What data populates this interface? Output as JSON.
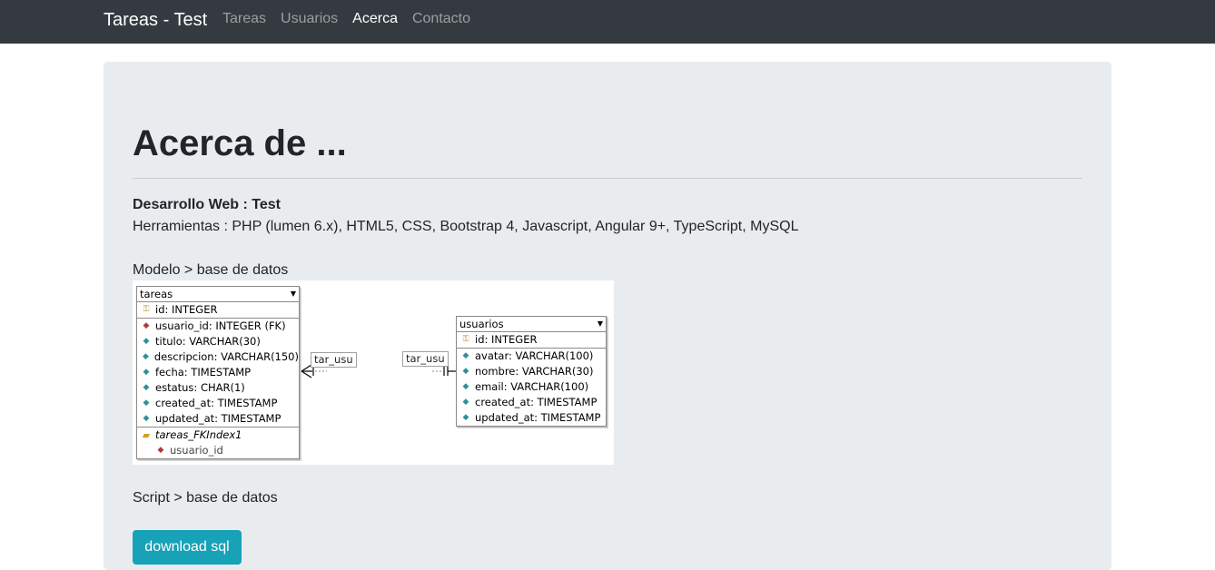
{
  "navbar": {
    "brand": "Tareas - Test",
    "links": [
      "Tareas",
      "Usuarios",
      "Acerca",
      "Contacto"
    ],
    "active": "Acerca"
  },
  "page": {
    "title": "Acerca de ...",
    "dev_line": "Desarrollo Web : Test",
    "tools_line": "Herramientas : PHP (lumen 6.x), HTML5, CSS, Bootstrap 4, Javascript, Angular 9+, TypeScript, MySQL",
    "model_label": "Modelo > base de datos",
    "script_label": "Script > base de datos",
    "download_button": "download sql"
  },
  "diagram": {
    "tareas": {
      "name": "tareas",
      "pk": "id: INTEGER",
      "fields": [
        {
          "icon": "fk",
          "text": "usuario_id: INTEGER (FK)"
        },
        {
          "icon": "col",
          "text": "titulo: VARCHAR(30)"
        },
        {
          "icon": "col",
          "text": "descripcion: VARCHAR(150)"
        },
        {
          "icon": "col",
          "text": "fecha: TIMESTAMP"
        },
        {
          "icon": "col",
          "text": "estatus: CHAR(1)"
        },
        {
          "icon": "col",
          "text": "created_at: TIMESTAMP"
        },
        {
          "icon": "col",
          "text": "updated_at: TIMESTAMP"
        }
      ],
      "index": "tareas_FKIndex1",
      "index_field": "usuario_id"
    },
    "usuarios": {
      "name": "usuarios",
      "pk": "id: INTEGER",
      "fields": [
        {
          "icon": "col",
          "text": "avatar: VARCHAR(100)"
        },
        {
          "icon": "col",
          "text": "nombre: VARCHAR(30)"
        },
        {
          "icon": "col",
          "text": "email: VARCHAR(100)"
        },
        {
          "icon": "col",
          "text": "created_at: TIMESTAMP"
        },
        {
          "icon": "col",
          "text": "updated_at: TIMESTAMP"
        }
      ]
    },
    "relation_left": "tar_usu",
    "relation_right": "tar_usu"
  },
  "colors": {
    "navbar_bg": "#343a40",
    "jumbotron_bg": "#e9ecef",
    "button_bg": "#17a2b8"
  }
}
